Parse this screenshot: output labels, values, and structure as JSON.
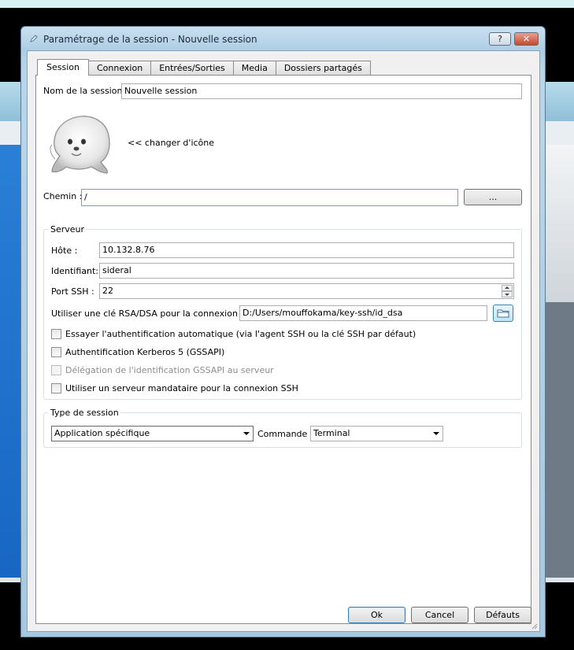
{
  "window": {
    "title": "Paramétrage de la session - Nouvelle session",
    "help_label": "?",
    "close_label": "✕"
  },
  "tabs": [
    {
      "label": "Session",
      "active": true
    },
    {
      "label": "Connexion",
      "active": false
    },
    {
      "label": "Entrées/Sorties",
      "active": false
    },
    {
      "label": "Media",
      "active": false
    },
    {
      "label": "Dossiers partagés",
      "active": false
    }
  ],
  "session": {
    "name_label": "Nom de la session :",
    "name_value": "Nouvelle session",
    "change_icon_label": "<< changer d'icône",
    "path_label": "Chemin :",
    "path_value": "/",
    "browse_label": "..."
  },
  "server": {
    "group_title": "Serveur",
    "host_label": "Hôte :",
    "host_value": "10.132.8.76",
    "user_label": "Identifiant:",
    "user_value": "sideral",
    "port_label": "Port SSH :",
    "port_value": "22",
    "key_label": "Utiliser une clé RSA/DSA pour la connexion SSH :",
    "key_value": "D:/Users/mouffokama/key-ssh/id_dsa",
    "options": [
      {
        "label": "Essayer l'authentification automatique (via l'agent SSH ou la clé SSH par défaut)",
        "checked": false,
        "enabled": true
      },
      {
        "label": "Authentification Kerberos 5 (GSSAPI)",
        "checked": false,
        "enabled": true
      },
      {
        "label": "Délégation de l'identification GSSAPI au serveur",
        "checked": false,
        "enabled": false
      },
      {
        "label": "Utiliser un serveur mandataire pour la connexion SSH",
        "checked": false,
        "enabled": true
      }
    ]
  },
  "session_type": {
    "group_title": "Type de session",
    "type_value": "Application spécifique",
    "command_label": "Commande :",
    "command_value": "Terminal"
  },
  "footer": {
    "ok_label": "Ok",
    "cancel_label": "Cancel",
    "defaults_label": "Défauts"
  }
}
